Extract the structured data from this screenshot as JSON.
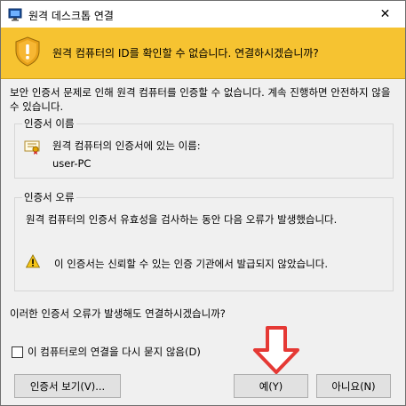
{
  "window": {
    "title": "원격 데스크톱 연결",
    "close_glyph": "✕"
  },
  "banner": {
    "message": "원격 컴퓨터의 ID를 확인할 수 없습니다. 연결하시겠습니까?"
  },
  "intro": {
    "text": "보안 인증서 문제로 인해 원격 컴퓨터를 인증할 수 없습니다. 계속 진행하면 안전하지 않을 수 있습니다."
  },
  "cert_name_group": {
    "legend": "인증서 이름",
    "label": "원격 컴퓨터의 인증서에 있는 이름:",
    "value": "user-PC"
  },
  "cert_error_group": {
    "legend": "인증서 오류",
    "text": "원격 컴퓨터의 인증서 유효성을 검사하는 동안 다음 오류가 발생했습니다.",
    "warning": "이 인증서는 신뢰할 수 있는 인증 기관에서 발급되지 않았습니다."
  },
  "question": "이러한 인증서 오류가 발생해도 연결하시겠습니까?",
  "checkbox": {
    "label": "이 컴퓨터로의 연결을 다시 묻지 않음(D)",
    "checked": false
  },
  "buttons": {
    "view_cert": "인증서 보기(V)...",
    "yes": "예(Y)",
    "no": "아니요(N)"
  },
  "colors": {
    "banner": "#f6c331",
    "arrow": "#e53935",
    "dialog_bg": "#f0f0f0"
  }
}
